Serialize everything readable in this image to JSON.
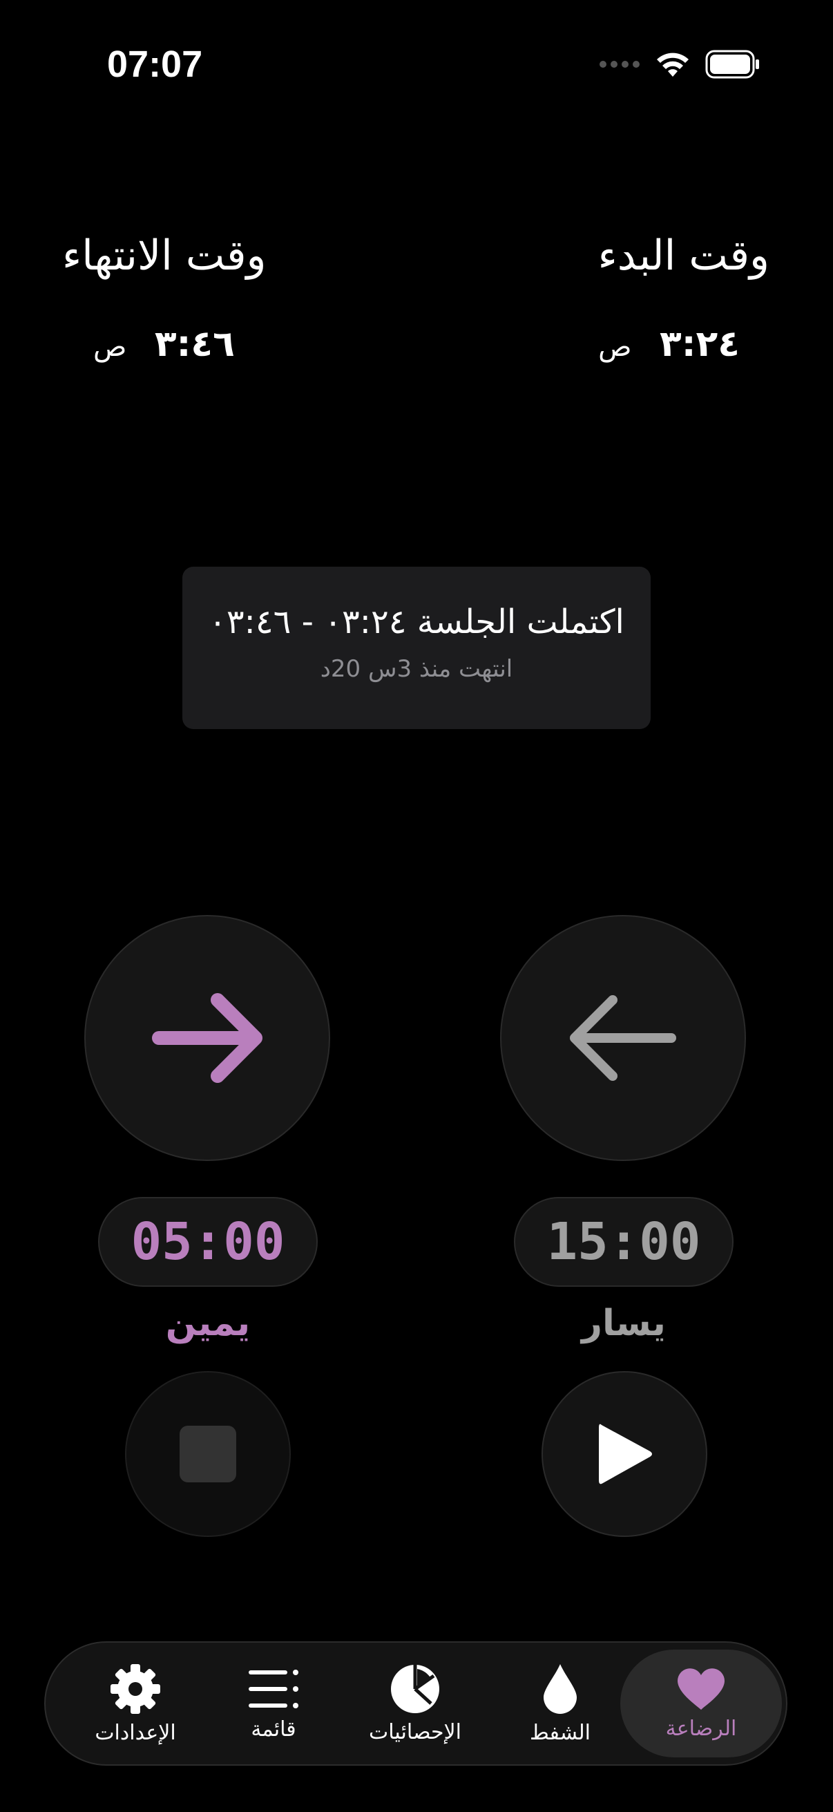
{
  "status": {
    "time": "07:07"
  },
  "header": {
    "start_label": "وقت البدء",
    "end_label": "وقت الانتهاء",
    "start_time": "٣:٢٤",
    "start_suffix": "ص",
    "end_time": "٣:٤٦",
    "end_suffix": "ص"
  },
  "banner": {
    "title": "اكتملت الجلسة ٠٣:٢٤ - ٠٣:٤٦",
    "subtitle": "انتهت منذ 3س 20د"
  },
  "sides": {
    "right": {
      "timer": "05:00",
      "label": "يمين",
      "color": "#b97fbd"
    },
    "left": {
      "timer": "15:00",
      "label": "يسار",
      "color": "#a0a0a0"
    }
  },
  "tabs": [
    {
      "label": "الإعدادات",
      "icon": "gear-icon"
    },
    {
      "label": "قائمة",
      "icon": "list-icon"
    },
    {
      "label": "الإحصائيات",
      "icon": "pie-chart-icon"
    },
    {
      "label": "الشفط",
      "icon": "drop-icon"
    },
    {
      "label": "الرضاعة",
      "icon": "heart-icon",
      "active": true
    }
  ],
  "colors": {
    "accent": "#b97fbd",
    "background": "#000000"
  }
}
